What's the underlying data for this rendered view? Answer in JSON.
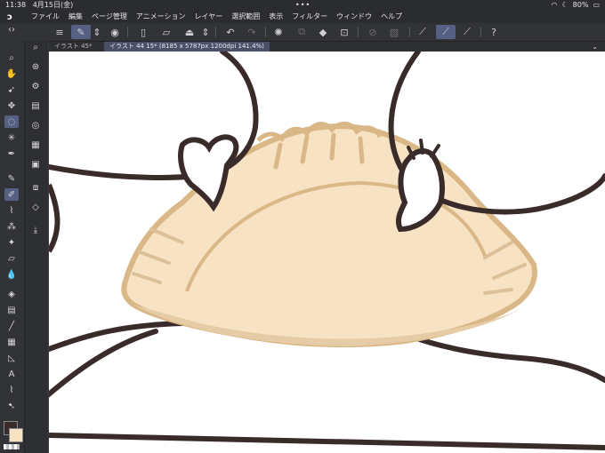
{
  "status": {
    "time": "11:38",
    "date": "4月15日(金)",
    "battery": "80%",
    "icons": [
      "wifi-icon",
      "moon-icon",
      "battery-icon"
    ]
  },
  "menu": {
    "items": [
      "ファイル",
      "編集",
      "ページ管理",
      "アニメーション",
      "レイヤー",
      "選択範囲",
      "表示",
      "フィルター",
      "ウィンドウ",
      "ヘルプ"
    ]
  },
  "tabs": [
    {
      "label": "イラスト 45*"
    },
    {
      "label": "イラスト 44 15* (8185 x 5787px 1200dpi 141.4%)"
    }
  ],
  "colors": {
    "ui_dark": "#2b2c2f",
    "accent": "#566083",
    "dough": "#f7e3c3",
    "dough_edge": "#d9b787",
    "hand_line": "#3a2b2b"
  }
}
